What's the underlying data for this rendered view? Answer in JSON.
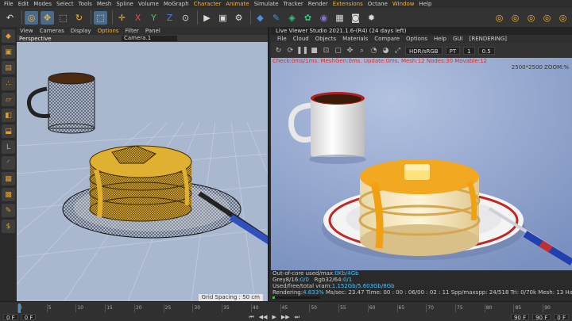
{
  "menubar": [
    "File",
    "Edit",
    "Modes",
    "Select",
    "Tools",
    "Mesh",
    "Spline",
    "Volume",
    "MoGraph",
    "Character",
    "Animate",
    "Simulate",
    "Tracker",
    "Render",
    "Extensions",
    "Octane",
    "Window",
    "Help"
  ],
  "menubar_highlight": [
    "Character",
    "Animate",
    "Extensions",
    "Window"
  ],
  "viewport": {
    "menu": [
      "View",
      "Cameras",
      "Display",
      "Options",
      "Filter",
      "Panel"
    ],
    "selected_menu": "Options",
    "view_name": "Perspective",
    "camera": "Camera.1",
    "grid_spacing": "Grid Spacing : 50 cm"
  },
  "liveviewer": {
    "title": "Live Viewer Studio 2021.1.6-(R4) (24 days left)",
    "menu": [
      "File",
      "Cloud",
      "Objects",
      "Materials",
      "Compare",
      "Options",
      "Help",
      "GUI",
      "[RENDERING]"
    ],
    "color_space": "HDR/sRGB",
    "pt": "PT",
    "field1": "1",
    "field2": "0.5",
    "overlay": "Check:0ms/1ms. MeshGen:0ms. Update:0ms. Mesh:12 Nodes:30 Movable:12",
    "resolution": "2500*2500 ZOOM:%",
    "stats": [
      {
        "label": "Out-of-core used/max:",
        "value": "0Kb/4Gb"
      },
      {
        "label": "Grey8/16:",
        "value": "0/0",
        "label2": "Rgb32/64:",
        "value2": "0/1"
      },
      {
        "label": "Used/free/total vram:",
        "value": "1.152Gb/5.603Gb/8Gb"
      },
      {
        "label": "Rendering:",
        "value": "4.833%",
        "label2": "Ms/sec: 23.47   Time: 00 : 00 : 06/00 : 02 : 11",
        "value2": "Spp/maxspp: 24/518   Tri: 0/70k   Mesh: 13   Hair: 0   RTXoff   GPU: 57"
      }
    ]
  },
  "timeline": {
    "ticks": [
      "0",
      "5",
      "10",
      "15",
      "20",
      "25",
      "30",
      "35",
      "40",
      "45",
      "50",
      "55",
      "60",
      "65",
      "70",
      "75",
      "80",
      "85",
      "90"
    ],
    "start_frame": "0 F",
    "current_frame": "0 F",
    "end_frame": "90 F",
    "end_frame2": "90 F",
    "right_frame": "0 F"
  },
  "colors": {
    "accent": "#f2b33d",
    "stats_value": "#4fc3f7",
    "viewport_bg": "#a9b8cf",
    "render_bg": "#8fa6cf"
  }
}
